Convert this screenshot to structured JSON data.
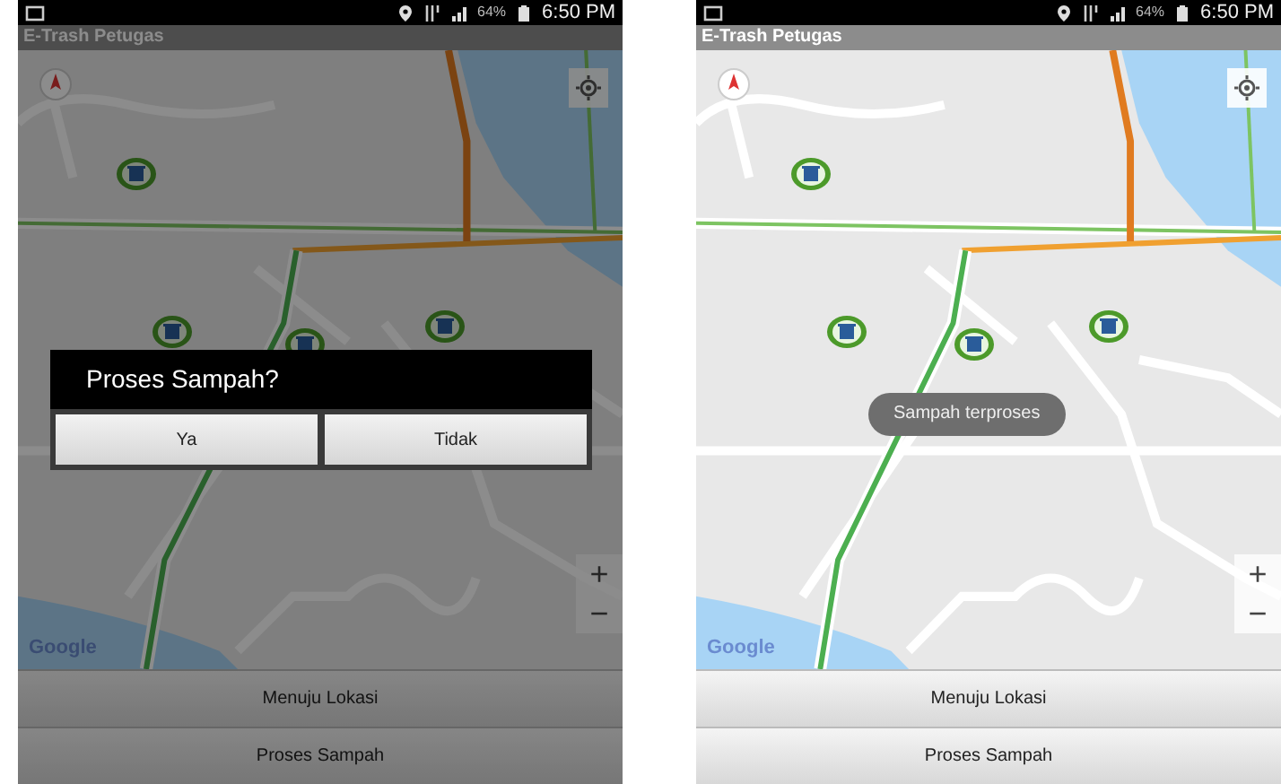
{
  "screens": [
    {
      "status_bar": {
        "battery": "64%",
        "time": "6:50 PM"
      },
      "app_title": "E-Trash Petugas",
      "map": {
        "attribution": "Google",
        "zoom_in": "+",
        "zoom_out": "−"
      },
      "buttons": [
        "Menuju Lokasi",
        "Proses Sampah"
      ],
      "overlay": {
        "kind": "dialog",
        "title": "Proses Sampah?",
        "buttons": [
          "Ya",
          "Tidak"
        ]
      }
    },
    {
      "status_bar": {
        "battery": "64%",
        "time": "6:50 PM"
      },
      "app_title": "E-Trash Petugas",
      "map": {
        "attribution": "Google",
        "zoom_in": "+",
        "zoom_out": "−"
      },
      "buttons": [
        "Menuju Lokasi",
        "Proses Sampah"
      ],
      "overlay": {
        "kind": "toast",
        "text": "Sampah terproses"
      }
    }
  ]
}
